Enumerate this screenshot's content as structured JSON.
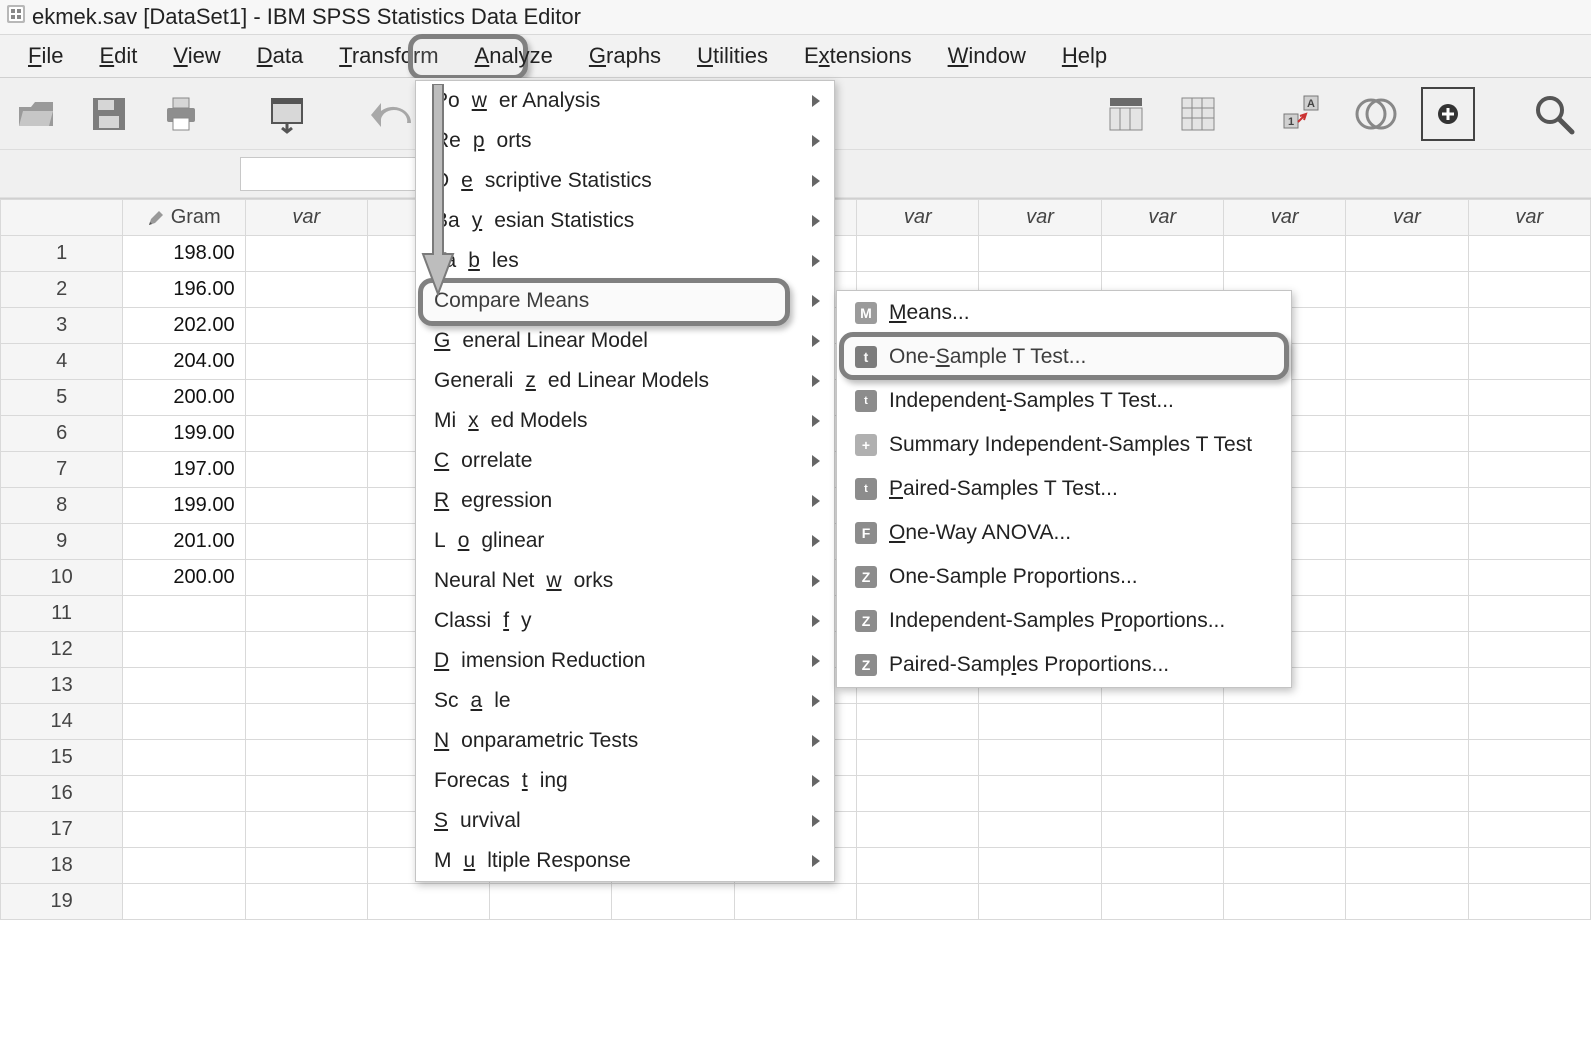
{
  "title": "ekmek.sav [DataSet1] - IBM SPSS Statistics Data Editor",
  "menubar": {
    "file": "File",
    "edit": "Edit",
    "view": "View",
    "data": "Data",
    "transform": "Transform",
    "analyze": "Analyze",
    "graphs": "Graphs",
    "utilities": "Utilities",
    "extensions": "Extensions",
    "window": "Window",
    "help": "Help"
  },
  "columns": {
    "c0": "Gram",
    "var": "var"
  },
  "rows": [
    {
      "n": "1",
      "v": "198.00"
    },
    {
      "n": "2",
      "v": "196.00"
    },
    {
      "n": "3",
      "v": "202.00"
    },
    {
      "n": "4",
      "v": "204.00"
    },
    {
      "n": "5",
      "v": "200.00"
    },
    {
      "n": "6",
      "v": "199.00"
    },
    {
      "n": "7",
      "v": "197.00"
    },
    {
      "n": "8",
      "v": "199.00"
    },
    {
      "n": "9",
      "v": "201.00"
    },
    {
      "n": "10",
      "v": "200.00"
    },
    {
      "n": "11",
      "v": ""
    },
    {
      "n": "12",
      "v": ""
    },
    {
      "n": "13",
      "v": ""
    },
    {
      "n": "14",
      "v": ""
    },
    {
      "n": "15",
      "v": ""
    },
    {
      "n": "16",
      "v": ""
    },
    {
      "n": "17",
      "v": ""
    },
    {
      "n": "18",
      "v": ""
    },
    {
      "n": "19",
      "v": ""
    }
  ],
  "analyze_menu": {
    "power": "Power Analysis",
    "reports": "Reports",
    "desc": "Descriptive Statistics",
    "bayes": "Bayesian Statistics",
    "tables": "Tables",
    "compare": "Compare Means",
    "glm": "General Linear Model",
    "genlin": "Generalized Linear Models",
    "mixed": "Mixed Models",
    "corr": "Correlate",
    "regr": "Regression",
    "loglin": "Loglinear",
    "neural": "Neural Networks",
    "classify": "Classify",
    "dimred": "Dimension Reduction",
    "scale": "Scale",
    "nonpar": "Nonparametric Tests",
    "forecast": "Forecasting",
    "survival": "Survival",
    "multiresp": "Multiple Response"
  },
  "compare_submenu": {
    "means": "Means...",
    "one_t": "One-Sample T Test...",
    "ind_t": "Independent-Samples T Test...",
    "sum_ind": "Summary Independent-Samples T Test",
    "paired_t": "Paired-Samples T Test...",
    "anova": "One-Way ANOVA...",
    "one_p": "One-Sample Proportions...",
    "ind_p": "Independent-Samples Proportions...",
    "paired_p": "Paired-Samples Proportions..."
  }
}
